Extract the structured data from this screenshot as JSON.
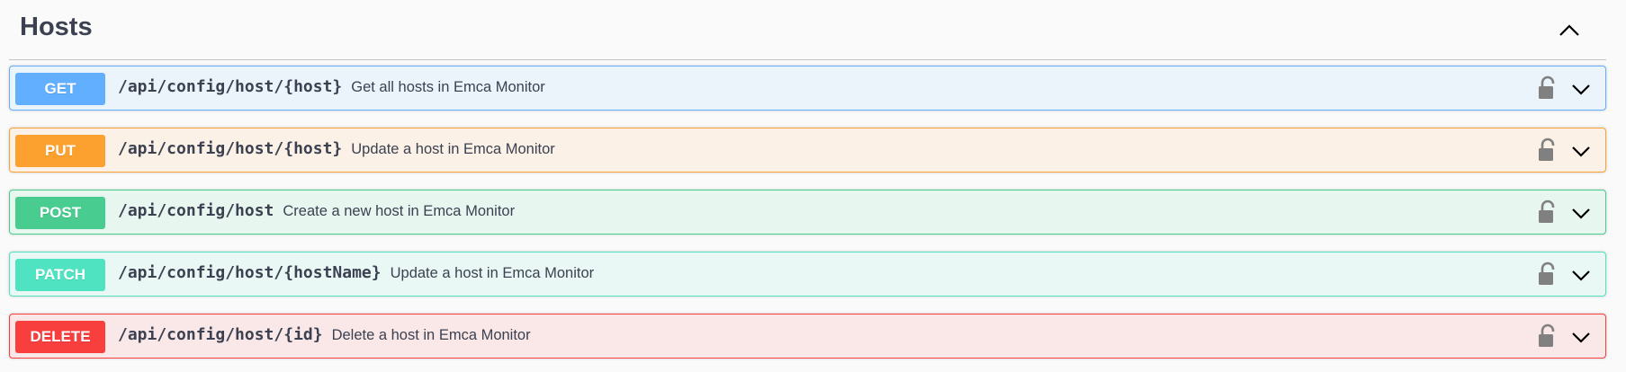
{
  "section": {
    "title": "Hosts"
  },
  "operations": [
    {
      "method": "GET",
      "path": "/api/config/host/{host}",
      "summary": "Get all hosts in Emca Monitor",
      "color": "#61affe",
      "bg": "#ebf3fb"
    },
    {
      "method": "PUT",
      "path": "/api/config/host/{host}",
      "summary": "Update a host in Emca Monitor",
      "color": "#fca130",
      "bg": "#fbf1e6"
    },
    {
      "method": "POST",
      "path": "/api/config/host",
      "summary": "Create a new host in Emca Monitor",
      "color": "#49cc90",
      "bg": "#e8f6f0"
    },
    {
      "method": "PATCH",
      "path": "/api/config/host/{hostName}",
      "summary": "Update a host in Emca Monitor",
      "color": "#50e3c2",
      "bg": "#e9f8f5"
    },
    {
      "method": "DELETE",
      "path": "/api/config/host/{id}",
      "summary": "Delete a host in Emca Monitor",
      "color": "#f93e3e",
      "bg": "#fae7e7"
    }
  ],
  "icons": {
    "collapse": "chevron-up-icon",
    "lock": "unlocked-padlock-icon",
    "expand": "chevron-down-icon"
  }
}
